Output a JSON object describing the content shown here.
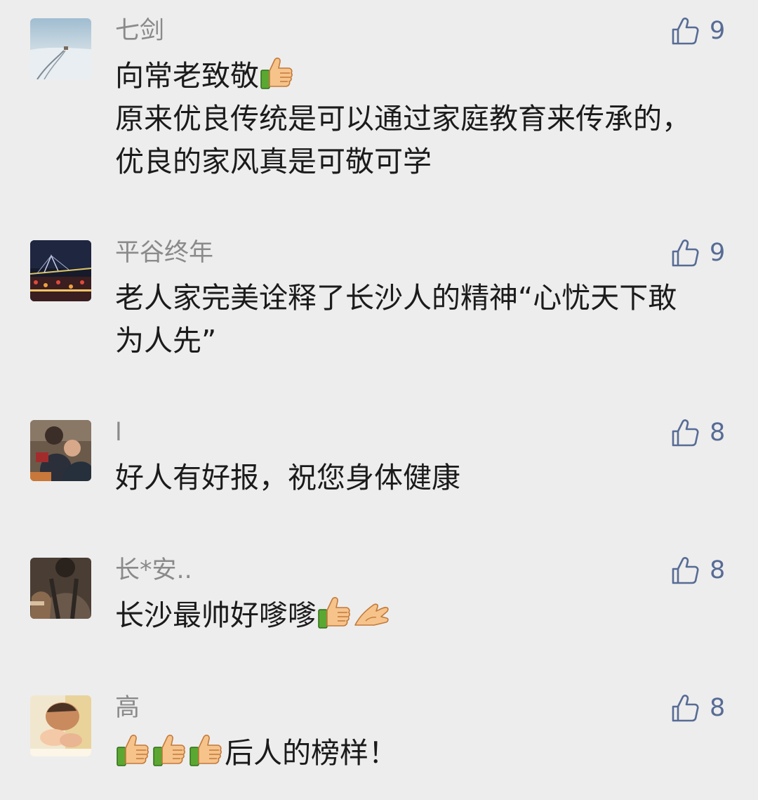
{
  "colors": {
    "background": "#ededed",
    "username": "#8a8a8a",
    "content": "#1b1b1b",
    "like_accent": "#576b95"
  },
  "comments": [
    {
      "username": "七剑",
      "avatar": "snowy-field-avatar",
      "likes": "9",
      "text_1": "向常老致敬",
      "text_2": "\n原来优良传统是可以通过家庭教育来传承的，优良的家风真是可敬可学",
      "emojis": [
        "thumbs-up"
      ]
    },
    {
      "username": "平谷终年",
      "avatar": "night-bridge-avatar",
      "likes": "9",
      "text": "老人家完美诠释了长沙人的精神“心忧天下敢为人先”"
    },
    {
      "username": "l",
      "avatar": "people-photo-avatar",
      "likes": "8",
      "text": "好人有好报，祝您身体健康"
    },
    {
      "username": "长*安..",
      "avatar": "backpack-person-avatar",
      "likes": "8",
      "text": "长沙最帅好嗲嗲",
      "emojis": [
        "thumbs-up",
        "ok-hand"
      ]
    },
    {
      "username": "高",
      "avatar": "child-photo-avatar",
      "likes": "8",
      "text": "后人的榜样！",
      "emojis": [
        "thumbs-up",
        "thumbs-up",
        "thumbs-up"
      ]
    }
  ]
}
